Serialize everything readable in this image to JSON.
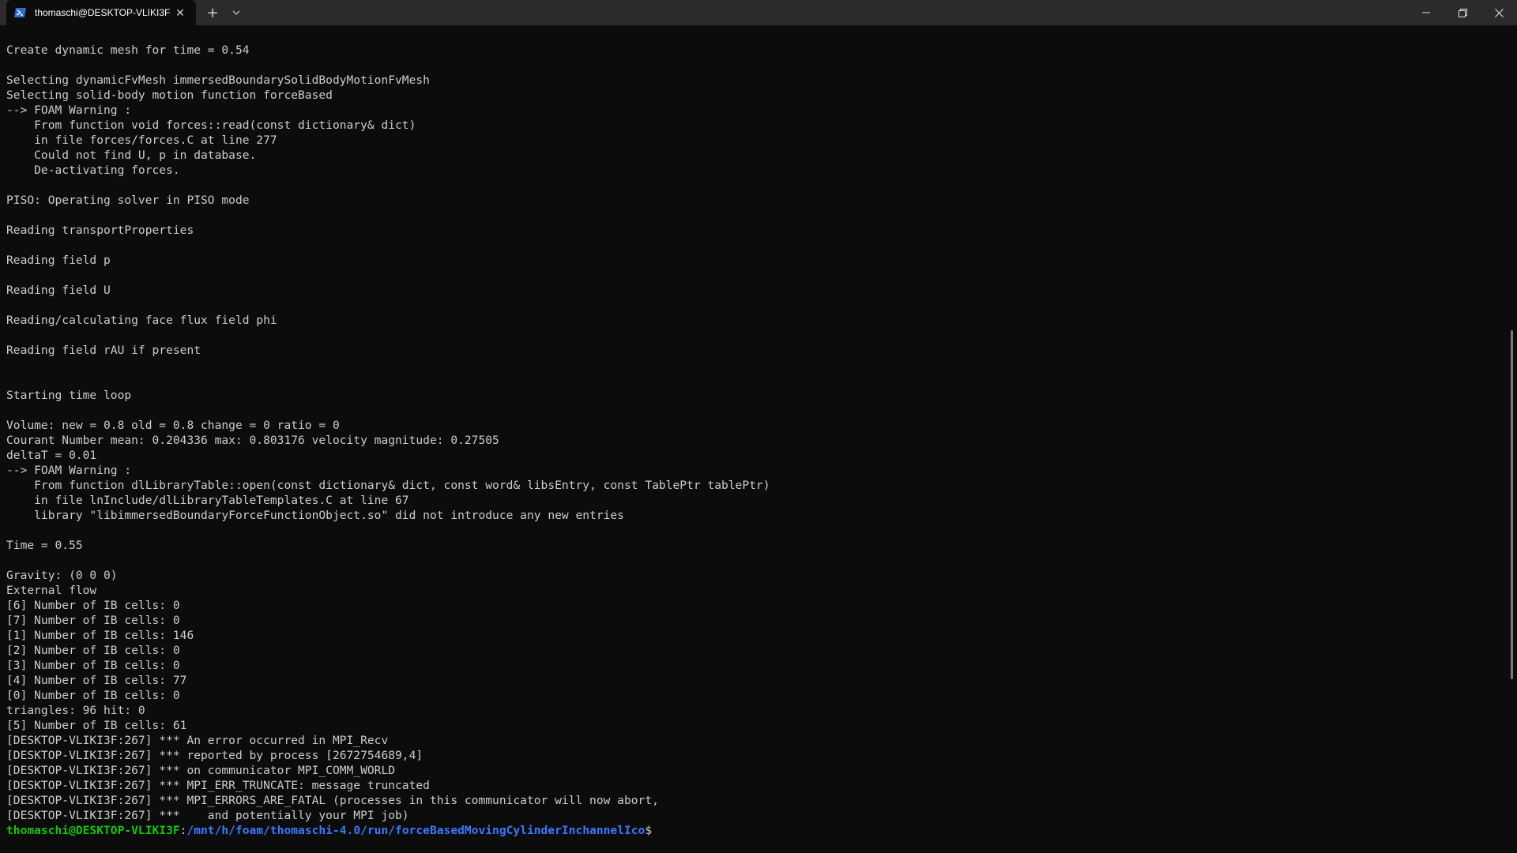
{
  "window": {
    "tab_title": "thomaschi@DESKTOP-VLIKI3F",
    "tab_icon": "powershell-icon",
    "new_tab_label": "+",
    "dropdown_label": "⌄",
    "close_tab_label": "✕"
  },
  "terminal": {
    "lines": [
      "Create dynamic mesh for time = 0.54",
      "",
      "Selecting dynamicFvMesh immersedBoundarySolidBodyMotionFvMesh",
      "Selecting solid-body motion function forceBased",
      "--> FOAM Warning :",
      "    From function void forces::read(const dictionary& dict)",
      "    in file forces/forces.C at line 277",
      "    Could not find U, p in database.",
      "    De-activating forces.",
      "",
      "PISO: Operating solver in PISO mode",
      "",
      "Reading transportProperties",
      "",
      "Reading field p",
      "",
      "Reading field U",
      "",
      "Reading/calculating face flux field phi",
      "",
      "Reading field rAU if present",
      "",
      "",
      "Starting time loop",
      "",
      "Volume: new = 0.8 old = 0.8 change = 0 ratio = 0",
      "Courant Number mean: 0.204336 max: 0.803176 velocity magnitude: 0.27505",
      "deltaT = 0.01",
      "--> FOAM Warning :",
      "    From function dlLibraryTable::open(const dictionary& dict, const word& libsEntry, const TablePtr tablePtr)",
      "    in file lnInclude/dlLibraryTableTemplates.C at line 67",
      "    library \"libimmersedBoundaryForceFunctionObject.so\" did not introduce any new entries",
      "",
      "Time = 0.55",
      "",
      "Gravity: (0 0 0)",
      "External flow",
      "[6] Number of IB cells: 0",
      "[7] Number of IB cells: 0",
      "[1] Number of IB cells: 146",
      "[2] Number of IB cells: 0",
      "[3] Number of IB cells: 0",
      "[4] Number of IB cells: 77",
      "[0] Number of IB cells: 0",
      "triangles: 96 hit: 0",
      "[5] Number of IB cells: 61",
      "[DESKTOP-VLIKI3F:267] *** An error occurred in MPI_Recv",
      "[DESKTOP-VLIKI3F:267] *** reported by process [2672754689,4]",
      "[DESKTOP-VLIKI3F:267] *** on communicator MPI_COMM_WORLD",
      "[DESKTOP-VLIKI3F:267] *** MPI_ERR_TRUNCATE: message truncated",
      "[DESKTOP-VLIKI3F:267] *** MPI_ERRORS_ARE_FATAL (processes in this communicator will now abort,",
      "[DESKTOP-VLIKI3F:267] ***    and potentially your MPI job)"
    ],
    "prompt": {
      "user_host": "thomaschi@DESKTOP-VLIKI3F",
      "separator": ":",
      "path": "/mnt/h/foam/thomaschi-4.0/run/forceBasedMovingCylinderInchannelIco",
      "symbol": "$"
    }
  },
  "colors": {
    "background": "#0c0c0c",
    "titlebar": "#2b2b2b",
    "text": "#cccccc",
    "prompt_user": "#16c60c",
    "prompt_path": "#3b78ff"
  }
}
